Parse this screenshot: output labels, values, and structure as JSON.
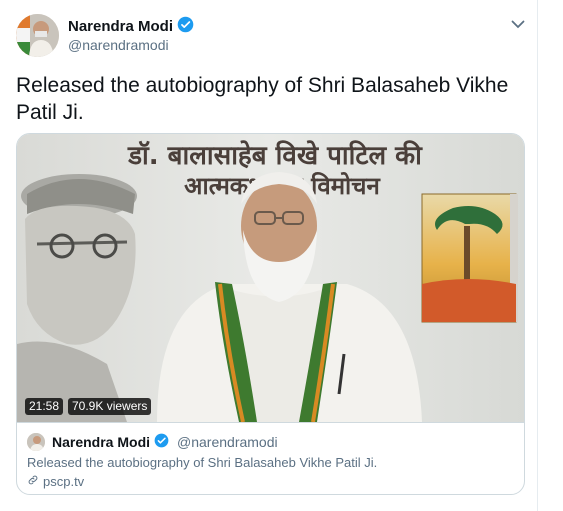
{
  "tweet": {
    "author_name": "Narendra Modi",
    "author_handle": "@narendramodi",
    "text": "Released the autobiography of Shri Balasaheb Vikhe Patil Ji."
  },
  "media": {
    "banner_line1": "डॉ. बालासाहेब विखे पाटिल की",
    "banner_line2": "आत्मकथा का विमोचन",
    "duration": "21:58",
    "viewers": "70.9K viewers"
  },
  "card": {
    "author_name": "Narendra Modi",
    "author_handle": "@narendramodi",
    "text": "Released the autobiography of Shri Balasaheb Vikhe Patil Ji.",
    "link": "pscp.tv"
  },
  "colors": {
    "verified": "#1d9bf0",
    "secondary_text": "#5b7083",
    "border": "#cfd9de"
  },
  "icons": {
    "verified": "verified-badge-icon",
    "chevron": "chevron-down-icon",
    "link": "link-icon"
  }
}
